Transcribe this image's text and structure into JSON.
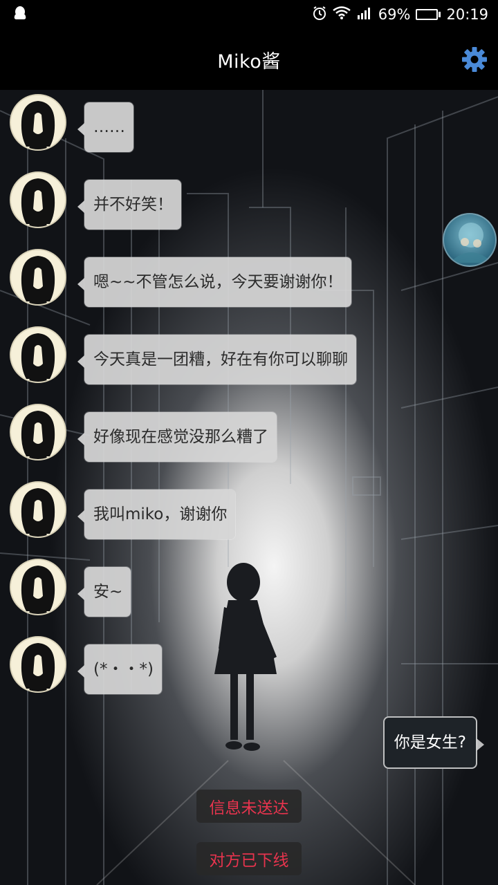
{
  "status_bar": {
    "battery": "69%",
    "time": "20:19",
    "battery_level": 0.69,
    "icons": [
      "qq-icon",
      "alarm-icon",
      "wifi-icon",
      "signal-icon",
      "battery-icon"
    ]
  },
  "header": {
    "title": "Miko酱",
    "settings_icon": "gear-icon",
    "accent": "#4a8ad8"
  },
  "messages": [
    {
      "text": "……"
    },
    {
      "text": "并不好笑！"
    },
    {
      "text": "嗯~~不管怎么说，今天要谢谢你！"
    },
    {
      "text": "今天真是一团糟，好在有你可以聊聊"
    },
    {
      "text": "好像现在感觉没那么糟了"
    },
    {
      "text": "我叫miko，谢谢你"
    },
    {
      "text": "安~"
    },
    {
      "text": "(*・・*)"
    }
  ],
  "sent_message": {
    "text": "你是女生?"
  },
  "notices": {
    "undelivered": "信息未送达",
    "offline": "对方已下线",
    "color": "#e8344e"
  }
}
